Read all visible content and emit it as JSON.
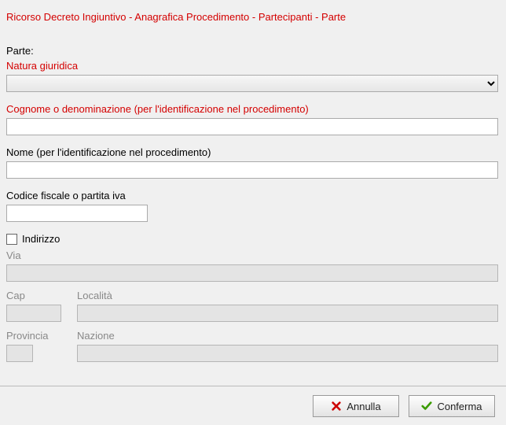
{
  "header": {
    "breadcrumb": "Ricorso Decreto Ingiuntivo - Anagrafica Procedimento - Partecipanti - Parte"
  },
  "section": {
    "title": "Parte:"
  },
  "fields": {
    "natura": {
      "label": "Natura giuridica",
      "value": ""
    },
    "cognome": {
      "label": "Cognome o denominazione (per l'identificazione nel procedimento)",
      "value": ""
    },
    "nome": {
      "label": "Nome (per l'identificazione nel procedimento)",
      "value": ""
    },
    "cf": {
      "label": "Codice fiscale o partita iva",
      "value": ""
    },
    "indirizzo_cb": {
      "label": "Indirizzo",
      "checked": false
    },
    "via": {
      "label": "Via",
      "value": ""
    },
    "cap": {
      "label": "Cap",
      "value": ""
    },
    "localita": {
      "label": "Località",
      "value": ""
    },
    "provincia": {
      "label": "Provincia",
      "value": ""
    },
    "nazione": {
      "label": "Nazione",
      "value": ""
    }
  },
  "buttons": {
    "cancel": "Annulla",
    "confirm": "Conferma"
  }
}
